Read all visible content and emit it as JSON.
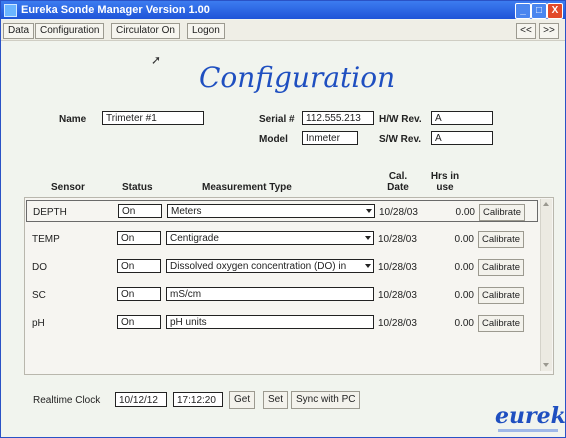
{
  "window": {
    "title": "Eureka Sonde Manager Version 1.00",
    "controls": {
      "minimize": "_",
      "maximize": "□",
      "close": "X"
    }
  },
  "menu": {
    "items": [
      "Data",
      "Configuration",
      "Circulator On",
      "Logon"
    ],
    "nav_prev": "<<",
    "nav_next": ">>"
  },
  "page": {
    "title": "Configuration"
  },
  "info": {
    "name_label": "Name",
    "name_value": "Trimeter #1",
    "serial_label": "Serial #",
    "serial_value": "112.555.213",
    "hw_label": "H/W Rev.",
    "hw_value": "A",
    "model_label": "Model",
    "model_value": "Inmeter",
    "sw_label": "S/W Rev.",
    "sw_value": "A"
  },
  "table": {
    "headers": {
      "sensor": "Sensor",
      "status": "Status",
      "type": "Measurement Type",
      "cal_date_1": "Cal.",
      "cal_date_2": "Date",
      "hrs_1": "Hrs in",
      "hrs_2": "use"
    },
    "rows": [
      {
        "sensor": "DEPTH",
        "status": "On",
        "type": "Meters",
        "dropdown": true,
        "date": "10/28/03",
        "hrs": "0.00",
        "action": "Calibrate"
      },
      {
        "sensor": "TEMP",
        "status": "On",
        "type": "Centigrade",
        "dropdown": true,
        "date": "10/28/03",
        "hrs": "0.00",
        "action": "Calibrate"
      },
      {
        "sensor": "DO",
        "status": "On",
        "type": "Dissolved oxygen concentration (DO) in",
        "dropdown": true,
        "date": "10/28/03",
        "hrs": "0.00",
        "action": "Calibrate"
      },
      {
        "sensor": "SC",
        "status": "On",
        "type": "mS/cm",
        "dropdown": false,
        "date": "10/28/03",
        "hrs": "0.00",
        "action": "Calibrate"
      },
      {
        "sensor": "pH",
        "status": "On",
        "type": "pH units",
        "dropdown": false,
        "date": "10/28/03",
        "hrs": "0.00",
        "action": "Calibrate"
      }
    ]
  },
  "clock": {
    "label": "Realtime Clock",
    "date": "10/12/12",
    "time": "17:12:20",
    "get_label": "Get",
    "set_label": "Set",
    "sync_label": "Sync with PC"
  },
  "logo": {
    "text": "eureka"
  },
  "colors": {
    "accent": "#1f4fc0",
    "titlebar": "#2a5ed8",
    "close": "#e24a2a"
  }
}
